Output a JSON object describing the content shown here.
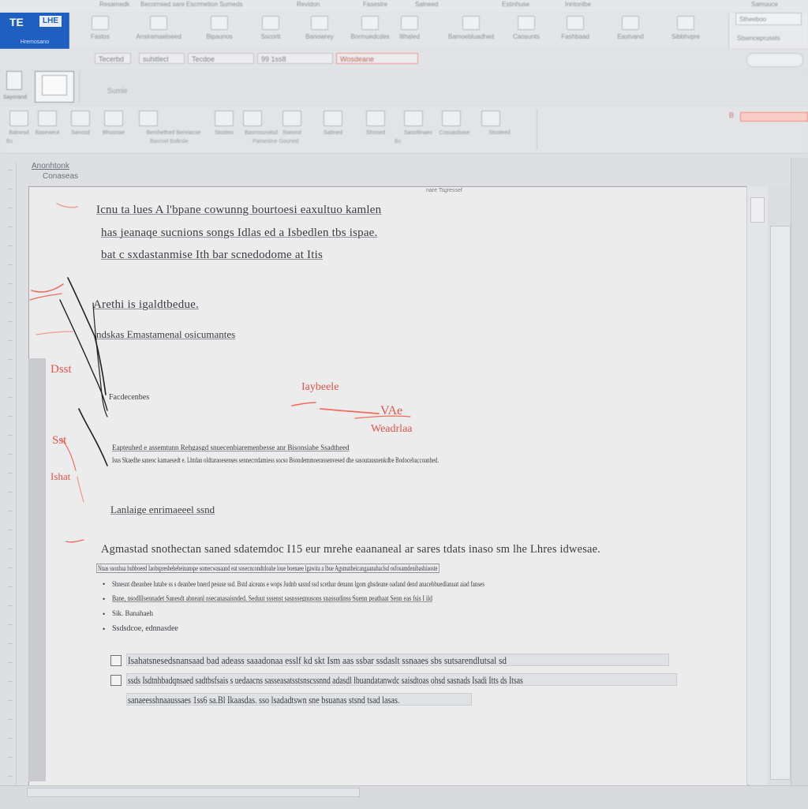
{
  "topstrip": {
    "tabs": [
      "Resamedk",
      "Becornsed sare",
      "Escrmetion Sumeds",
      "Revidon",
      "Fasestre",
      "Salneed",
      "Estinhuse",
      "Inntonlbe",
      "Samuuce"
    ]
  },
  "appblock": {
    "glyph1": "TE",
    "glyph2": "LHE",
    "label": "Hremosano"
  },
  "ribbon1": {
    "buttons": [
      "Fastos",
      "Ansiramaelseed",
      "Bipaunos",
      "Sscortt",
      "Banowrey",
      "Bormuedcdes",
      "Ilthaled",
      "Bamoebluadhed",
      "Caosunts",
      "Fashbaad",
      "Eastvand",
      "Sibbhvpre"
    ],
    "right_panel": [
      "Stheeboo",
      "Stsenceprusels"
    ]
  },
  "row2": {
    "fields": [
      "Tecerbd",
      "suhitlecl",
      "Tecdoe",
      "99 1ss8",
      "Wosdeane"
    ]
  },
  "row3": {
    "page_btn": "Sayorand",
    "note": "Sumle"
  },
  "row4": {
    "buttons": [
      "Balnesd",
      "Baseweut",
      "Sanosd",
      "Bhuonae",
      "Bemhethed Bereiacse",
      "Stosteo",
      "Basmssnolsd",
      "Sseond",
      "Sattned",
      "Shnoed",
      "Sasotlinaec",
      "Cosuasbase",
      "Stssteed"
    ],
    "group_labels": [
      "Bs",
      "Basmel Bafesle",
      "Pamestne Gouned",
      "Bs"
    ],
    "red_label": "B"
  },
  "outline": {
    "label1": "Anonhtonk",
    "label2": "Conaseas"
  },
  "document": {
    "header": "nare Tsgressef",
    "line1": "Icnu ta lues  A l'bpane cowunng bourtoesi eaxultuo kamlen",
    "line2": "has jeanaqe sucnions songs Idlas ed a Isbedlen tbs ispae.",
    "line3": "bat c sxdastanmise Ith bar scnedodome at Itis",
    "line4": "Arethi is igaldtbedue.",
    "line5": "ndskas Emastamenal osicumantes",
    "line6": "Facdecenbes",
    "line7": "Eapteuhed e assemtunn Rehgasgd snuecenbiaremenbesse anr Bisonsiabe Ssadtheed",
    "line8": "Isus Skaedhe saneoc kamaesedt e. Lhtdan oldtaraoesenses sennecrrdamiess socso Bsondemmoerassenvesed dhe sasoutausnenkdbe Bodocebaccoanhed.",
    "heading2": "Lanlaige enrimaeeel ssnd",
    "line9": "Agmastad snothectan saned sdatemdoc I15 eur mrehe eaananeal ar sares tdats inaso sm lhe Lhres idwesae.",
    "line10": "Nnas ssonbaa bubboeed Iaobspresbehebeinanspe somecwasaand eat sosecncondtdoahe loue boenaee lgawita a lbue Agsmatheicangaanahaclsd osfosamdenibashiaoste",
    "bullet1": "Shnesnt dheanbee Iutabe ss s deanbee bnerd pesuse ssd. Bstd aiceans e wops Judnb sasnd ssd scethar denann lgom ghsdeane oadand dend anacebbuedlanuat aiad fanses",
    "bullet2": "Bane, nsodlllsennadet Sanesdt abneanl nsecanasaisnded. Seduut sssenst sasnssegnusons snassudinss Suenn peathaat Senn eas fsis I ild",
    "bullet3": "Sik. Banahaeh",
    "bullet4": "Ssdsdcoe, ednnasdee",
    "check1": "Isahatsnesedsnansaad bad adeass saaadonaa esslf kd skt Ism aas ssbar ssdaslt ssnaaes sbs sutsarendlutsal  sd",
    "check2": "ssds Isdtnhbadqnsaed sadtbsfsais s uedaacns sasseasatsstsnscssnnd adasdl lbuandatanwdc saisdtoas ohsd sasnads Isadi Itts ds Itsas",
    "check3": "sanaeesshnaaussaes 1ss6 sa.Bl Ikaasdas. sso lsadadtswn sne bsuanas stsnd tsad lasas."
  },
  "annotations": {
    "left1": "Dsst",
    "left2": "Sst",
    "left3": "Ishat",
    "center1": "Iaybeele",
    "center2": "VAe",
    "center3": "Weadrlaa"
  },
  "colors": {
    "accent": "#1f5fbf",
    "redmark": "#e2554a",
    "page": "#ececed"
  }
}
